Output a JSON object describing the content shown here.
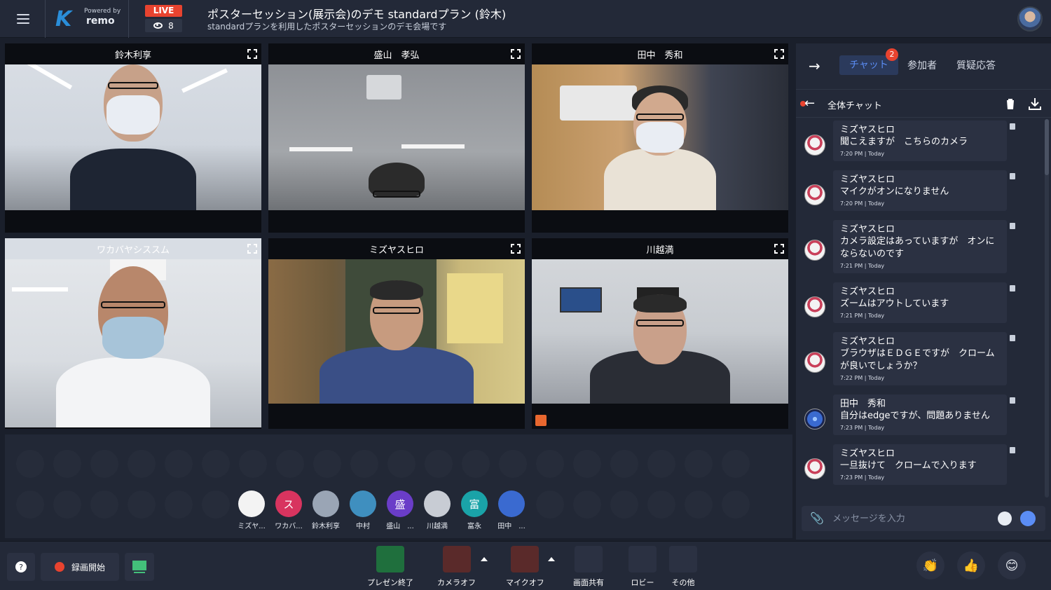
{
  "header": {
    "brand_powered": "Powered by",
    "brand_name": "remo",
    "live": "LIVE",
    "viewers": "8",
    "title": "ポスターセッション(展示会)のデモ standardプラン (鈴木)",
    "subtitle": "standardプランを利用したポスターセッションのデモ会場です"
  },
  "tiles": [
    {
      "name": "鈴木利享"
    },
    {
      "name": "盛山　孝弘"
    },
    {
      "name": "田中　秀和"
    },
    {
      "name": "ワカバヤシススム"
    },
    {
      "name": "ミズヤスヒロ"
    },
    {
      "name": "川越満"
    }
  ],
  "participants": [
    {
      "name": "ミズヤ...",
      "initial": "",
      "color": "#f3f3f3"
    },
    {
      "name": "ワカバ...",
      "initial": "ス",
      "color": "#d8345f"
    },
    {
      "name": "鈴木利享",
      "initial": "",
      "color": "#9aa5b5"
    },
    {
      "name": "中村",
      "initial": "",
      "color": "#3f8fbf"
    },
    {
      "name": "盛山　...",
      "initial": "盛",
      "color": "#6a3dc8"
    },
    {
      "name": "川越満",
      "initial": "",
      "color": "#c8ccd4"
    },
    {
      "name": "富永",
      "initial": "富",
      "color": "#1aa3a8"
    },
    {
      "name": "田中　...",
      "initial": "",
      "color": "#3a6ad0"
    }
  ],
  "chat": {
    "tabs": {
      "chat": "チャット",
      "participants": "参加者",
      "qa": "質疑応答"
    },
    "badge": "2",
    "room_title": "全体チャット",
    "messages": [
      {
        "name": "ミズヤスヒロ",
        "text": "聞こえますが　こちらのカメラ",
        "time": "7:20 PM | Today"
      },
      {
        "name": "ミズヤスヒロ",
        "text": "マイクがオンになりません",
        "time": "7:20 PM | Today"
      },
      {
        "name": "ミズヤスヒロ",
        "text": "カメラ設定はあっていますが　オンにならないのです",
        "time": "7:21 PM | Today"
      },
      {
        "name": "ミズヤスヒロ",
        "text": "ズームはアウトしています",
        "time": "7:21 PM | Today"
      },
      {
        "name": "ミズヤスヒロ",
        "text": "ブラウザはＥＤＧＥですが　クロームが良いでしょうか？",
        "time": "7:22 PM | Today"
      },
      {
        "name": "田中　秀和",
        "text": "自分はedgeですが、問題ありません",
        "time": "7:23 PM | Today"
      },
      {
        "name": "ミズヤスヒロ",
        "text": "一旦抜けて　クロームで入ります",
        "time": "7:23 PM | Today"
      }
    ],
    "input_placeholder": "メッセージを入力"
  },
  "toolbar": {
    "record": "録画開始",
    "present_end": "プレゼン終了",
    "camera_off": "カメラオフ",
    "mic_off": "マイクオフ",
    "screen_share": "画面共有",
    "lobby": "ロビー",
    "more": "その他"
  }
}
